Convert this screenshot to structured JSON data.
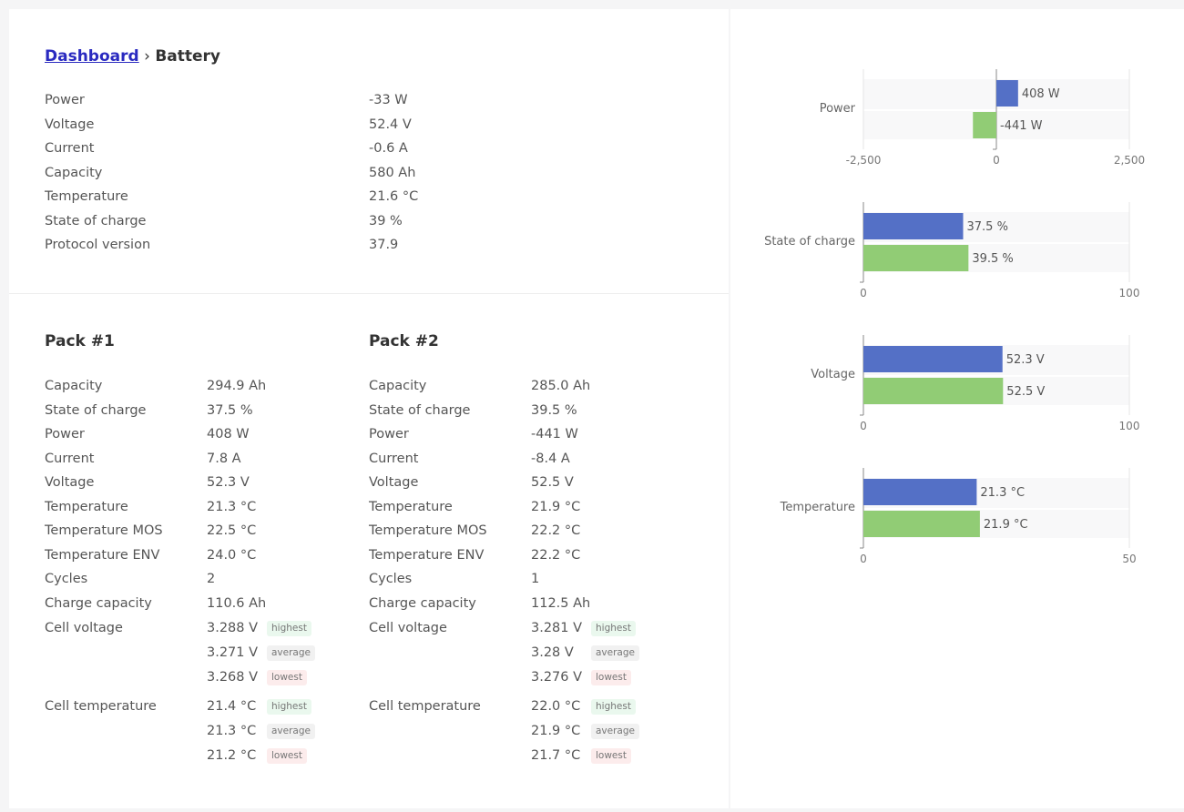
{
  "breadcrumb": {
    "parent": "Dashboard",
    "separator": "›",
    "current": "Battery"
  },
  "summary": [
    {
      "label": "Power",
      "value": "-33 W"
    },
    {
      "label": "Voltage",
      "value": "52.4 V"
    },
    {
      "label": "Current",
      "value": "-0.6 A"
    },
    {
      "label": "Capacity",
      "value": "580 Ah"
    },
    {
      "label": "Temperature",
      "value": "21.6 °C"
    },
    {
      "label": "State of charge",
      "value": "39 %"
    },
    {
      "label": "Protocol version",
      "value": "37.9"
    }
  ],
  "packs": [
    {
      "title": "Pack #1",
      "rows": [
        {
          "label": "Capacity",
          "value": "294.9 Ah"
        },
        {
          "label": "State of charge",
          "value": "37.5 %"
        },
        {
          "label": "Power",
          "value": "408 W"
        },
        {
          "label": "Current",
          "value": "7.8 A"
        },
        {
          "label": "Voltage",
          "value": "52.3 V"
        },
        {
          "label": "Temperature",
          "value": "21.3 °C"
        },
        {
          "label": "Temperature MOS",
          "value": "22.5 °C"
        },
        {
          "label": "Temperature ENV",
          "value": "24.0 °C"
        },
        {
          "label": "Cycles",
          "value": "2"
        },
        {
          "label": "Charge capacity",
          "value": "110.6 Ah"
        }
      ],
      "cell_voltage": {
        "label": "Cell voltage",
        "items": [
          {
            "value": "3.288 V",
            "tag": "highest"
          },
          {
            "value": "3.271 V",
            "tag": "average"
          },
          {
            "value": "3.268 V",
            "tag": "lowest"
          }
        ]
      },
      "cell_temperature": {
        "label": "Cell temperature",
        "items": [
          {
            "value": "21.4 °C",
            "tag": "highest"
          },
          {
            "value": "21.3 °C",
            "tag": "average"
          },
          {
            "value": "21.2 °C",
            "tag": "lowest"
          }
        ]
      }
    },
    {
      "title": "Pack #2",
      "rows": [
        {
          "label": "Capacity",
          "value": "285.0 Ah"
        },
        {
          "label": "State of charge",
          "value": "39.5 %"
        },
        {
          "label": "Power",
          "value": "-441 W"
        },
        {
          "label": "Current",
          "value": "-8.4 A"
        },
        {
          "label": "Voltage",
          "value": "52.5 V"
        },
        {
          "label": "Temperature",
          "value": "21.9 °C"
        },
        {
          "label": "Temperature MOS",
          "value": "22.2 °C"
        },
        {
          "label": "Temperature ENV",
          "value": "22.2 °C"
        },
        {
          "label": "Cycles",
          "value": "1"
        },
        {
          "label": "Charge capacity",
          "value": "112.5 Ah"
        }
      ],
      "cell_voltage": {
        "label": "Cell voltage",
        "items": [
          {
            "value": "3.281 V",
            "tag": "highest"
          },
          {
            "value": "3.28 V",
            "tag": "average"
          },
          {
            "value": "3.276 V",
            "tag": "lowest"
          }
        ]
      },
      "cell_temperature": {
        "label": "Cell temperature",
        "items": [
          {
            "value": "22.0 °C",
            "tag": "highest"
          },
          {
            "value": "21.9 °C",
            "tag": "average"
          },
          {
            "value": "21.7 °C",
            "tag": "lowest"
          }
        ]
      }
    }
  ],
  "colors": {
    "pack1": "#5470c6",
    "pack2": "#91cc75"
  },
  "chart_data": [
    {
      "type": "bar",
      "category": "Power",
      "values": [
        408,
        -441
      ],
      "labels": [
        "408 W",
        "-441 W"
      ],
      "xlim": [
        -2500,
        2500
      ],
      "ticks": [
        "-2,500",
        "0",
        "2,500"
      ]
    },
    {
      "type": "bar",
      "category": "State of charge",
      "values": [
        37.5,
        39.5
      ],
      "labels": [
        "37.5 %",
        "39.5 %"
      ],
      "xlim": [
        0,
        100
      ],
      "ticks": [
        "0",
        "100"
      ]
    },
    {
      "type": "bar",
      "category": "Voltage",
      "values": [
        52.3,
        52.5
      ],
      "labels": [
        "52.3 V",
        "52.5 V"
      ],
      "xlim": [
        0,
        100
      ],
      "ticks": [
        "0",
        "100"
      ]
    },
    {
      "type": "bar",
      "category": "Temperature",
      "values": [
        21.3,
        21.9
      ],
      "labels": [
        "21.3 °C",
        "21.9 °C"
      ],
      "xlim": [
        0,
        50
      ],
      "ticks": [
        "0",
        "50"
      ]
    }
  ]
}
